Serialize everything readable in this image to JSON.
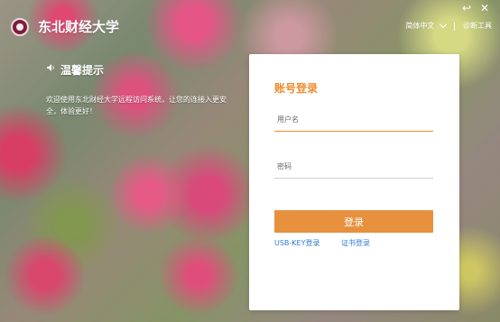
{
  "header": {
    "title": "东北财经大学",
    "language": "简体中文",
    "diagnose": "诊断工具"
  },
  "notice": {
    "title": "温馨提示",
    "message": "欢迎使用东北财经大学远程访问系统，让您的连接入更安全，体验更好！"
  },
  "login": {
    "title": "账号登录",
    "username_placeholder": "用户名",
    "password_placeholder": "密码",
    "login_button": "登录",
    "usb_key_login": "USB-KEY登录",
    "certificate_login": "证书登录"
  },
  "icons": {
    "logo": "university-logo",
    "speaker": "speaker-icon",
    "dropdown": "chevron-down-icon",
    "back": "back-icon",
    "close": "close-icon"
  },
  "colors": {
    "accent": "#e7913f",
    "accent_text": "#f08c2f",
    "link": "#2f7cd6"
  }
}
